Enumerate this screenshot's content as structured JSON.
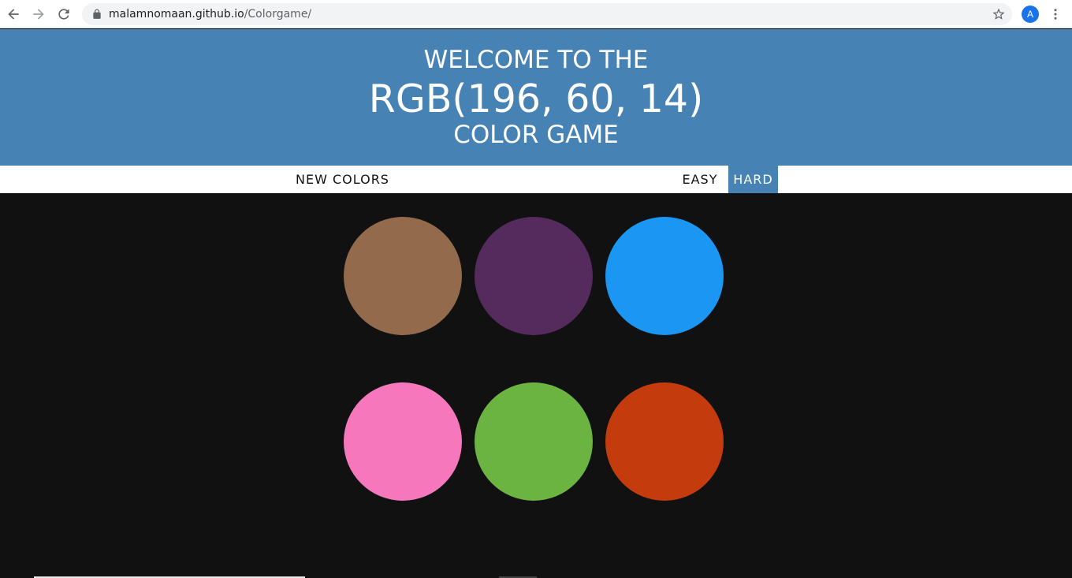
{
  "browser": {
    "url_host": "malamnomaan.github.io",
    "url_path": "/Colorgame/",
    "profile_initial": "A"
  },
  "header": {
    "line1": "WELCOME TO THE",
    "rgb_display": "RGB(196, 60, 14)",
    "line3": "COLOR GAME",
    "background_color": "#4682b4"
  },
  "controls": {
    "new_colors_label": "NEW COLORS",
    "easy_label": "EASY",
    "hard_label": "HARD",
    "selected_mode": "HARD",
    "selected_color": "#4682b4"
  },
  "board": {
    "background_color": "#111111",
    "squares": [
      {
        "color": "#936a4b"
      },
      {
        "color": "#552a5c"
      },
      {
        "color": "#1b96f3"
      },
      {
        "color": "#f777bc"
      },
      {
        "color": "#6cb442"
      },
      {
        "color": "#c43c0e"
      }
    ]
  }
}
